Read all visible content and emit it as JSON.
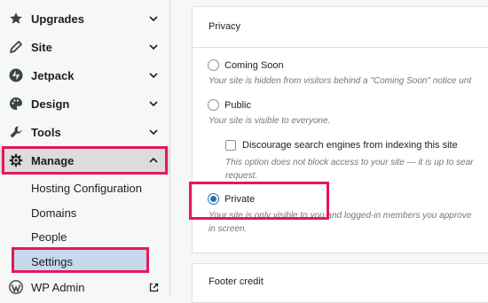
{
  "sidebar": {
    "items": [
      {
        "label": "Upgrades",
        "icon": "star-icon"
      },
      {
        "label": "Site",
        "icon": "pencil-icon"
      },
      {
        "label": "Jetpack",
        "icon": "jetpack-icon"
      },
      {
        "label": "Design",
        "icon": "palette-icon"
      },
      {
        "label": "Tools",
        "icon": "wrench-icon"
      },
      {
        "label": "Manage",
        "icon": "gear-icon"
      }
    ],
    "submenu": [
      "Hosting Configuration",
      "Domains",
      "People",
      "Settings"
    ],
    "wp_admin": {
      "label": "WP Admin",
      "icon": "wordpress-icon"
    }
  },
  "privacy": {
    "title": "Privacy",
    "coming_soon": {
      "label": "Coming Soon",
      "desc": "Your site is hidden from visitors behind a \"Coming Soon\" notice unt"
    },
    "public": {
      "label": "Public",
      "desc": "Your site is visible to everyone."
    },
    "discourage": {
      "label": "Discourage search engines from indexing this site",
      "desc_line1": "This option does not block access to your site — it is up to sear",
      "desc_line2": "request."
    },
    "private": {
      "label": "Private",
      "desc_line1": "Your site is only visible to you and logged-in members you approve",
      "desc_line2": "in screen.",
      "selected": true
    }
  },
  "footer_credit": {
    "title": "Footer credit"
  },
  "colors": {
    "accent": "#2271b1",
    "highlight": "#e6175c",
    "selected_bg": "#c5d9ed"
  }
}
